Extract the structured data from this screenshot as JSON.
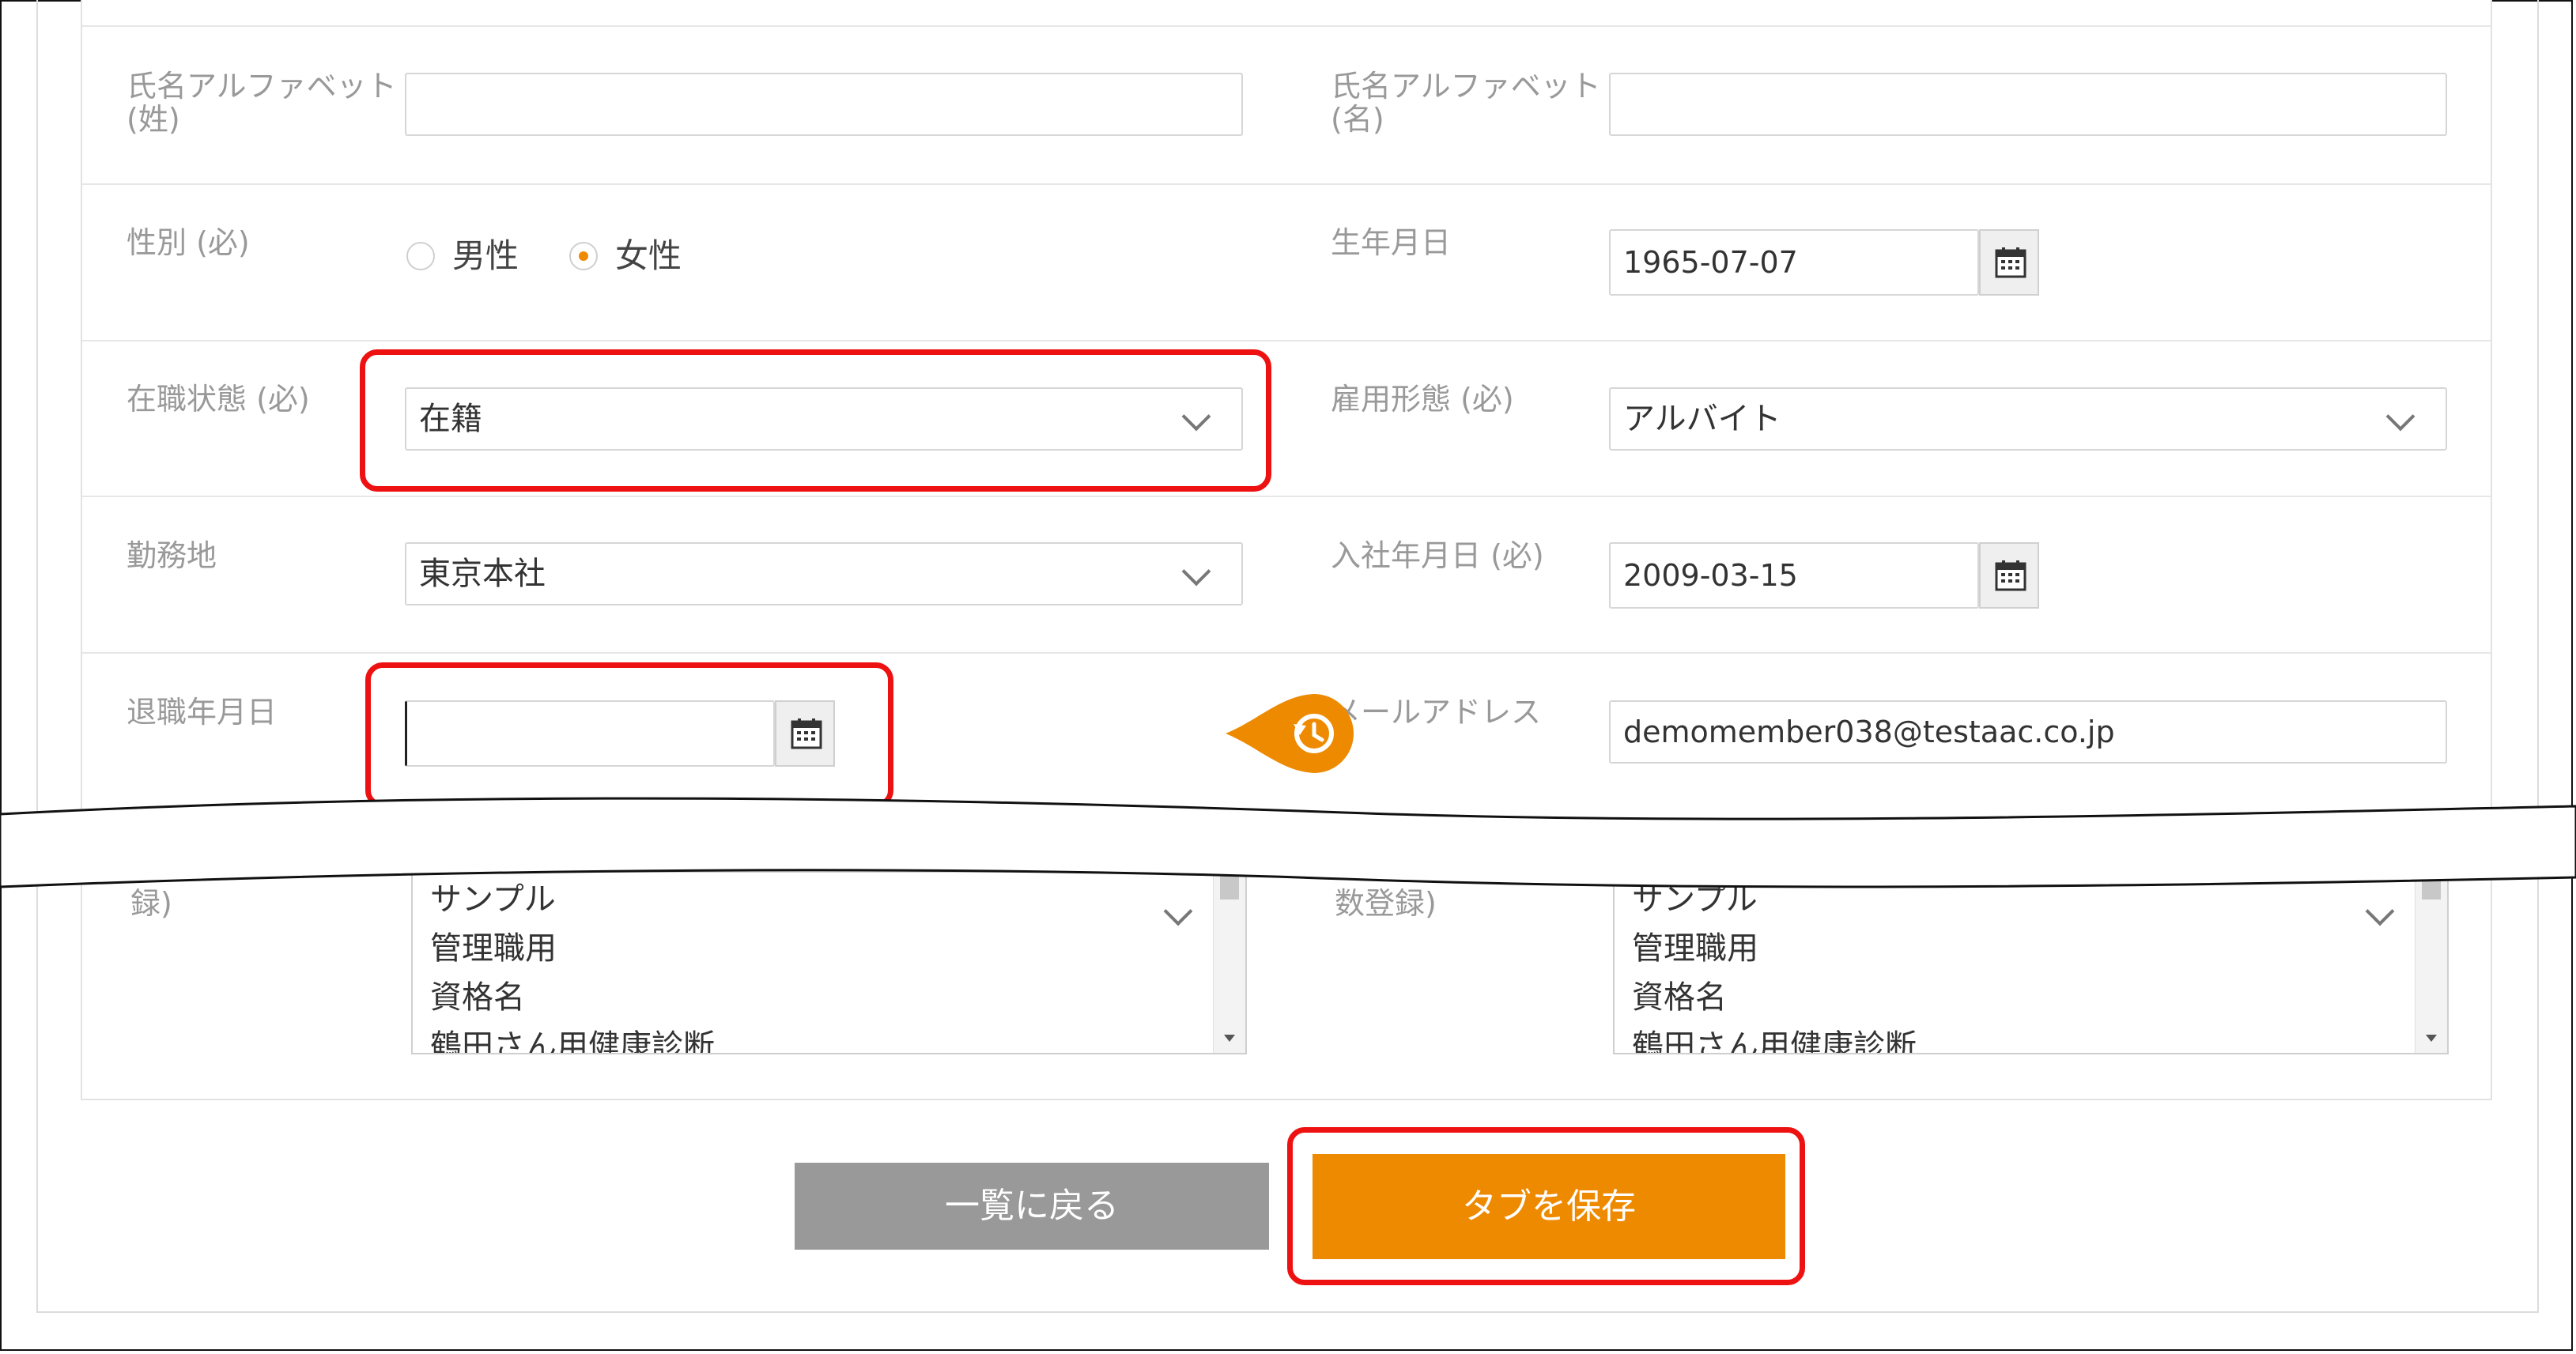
{
  "form": {
    "name_alpha_last": {
      "label": "氏名アルファベット(姓)",
      "value": ""
    },
    "name_alpha_first": {
      "label": "氏名アルファベット(名)",
      "value": ""
    },
    "gender": {
      "label": "性別 (必)",
      "options": [
        "男性",
        "女性"
      ],
      "selected": "女性"
    },
    "birthdate": {
      "label": "生年月日",
      "value": "1965-07-07",
      "icon": "calendar-icon"
    },
    "employment_status": {
      "label": "在職状態 (必)",
      "value": "在籍"
    },
    "employment_type": {
      "label": "雇用形態 (必)",
      "value": "アルバイト"
    },
    "work_location": {
      "label": "勤務地",
      "value": "東京本社"
    },
    "hire_date": {
      "label": "入社年月日 (必)",
      "value": "2009-03-15",
      "icon": "calendar-icon"
    },
    "retirement_date": {
      "label": "退職年月日",
      "value": "",
      "icon": "calendar-icon"
    },
    "email": {
      "label": "メールアドレス",
      "value": "demomember038@testaac.co.jp"
    },
    "multi_left": {
      "label_tail": "録)",
      "items": [
        "サンプル",
        "管理職用",
        "資格名",
        "鶴田さん用健康診断"
      ]
    },
    "multi_right": {
      "label_tail": "数登録)",
      "items": [
        "サンプル",
        "管理職用",
        "資格名",
        "鶴田さん用健康診断"
      ]
    }
  },
  "buttons": {
    "back": "一覧に戻る",
    "save": "タブを保存"
  },
  "colors": {
    "accent": "#EE8A00",
    "highlight": "#EE1111",
    "back_button": "#999999"
  },
  "icons": {
    "history": "history-icon"
  }
}
